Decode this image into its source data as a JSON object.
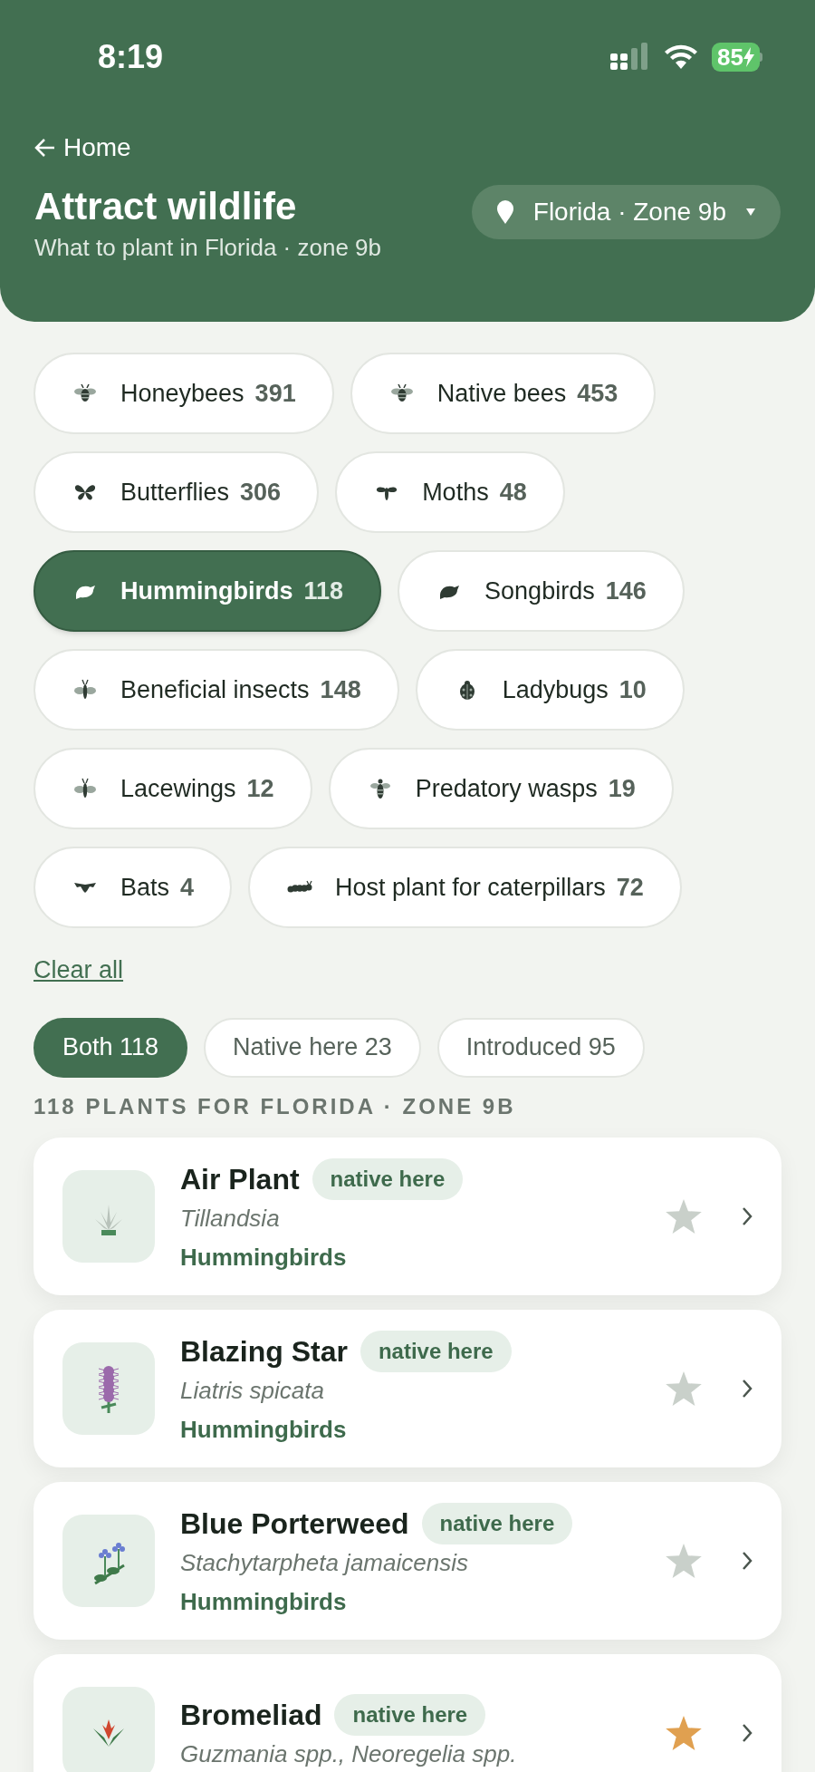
{
  "status_bar": {
    "time": "8:19",
    "battery": "85"
  },
  "header": {
    "back": "Home",
    "title": "Attract wildlife",
    "subtitle": "What to plant in Florida · zone 9b",
    "location": "Florida · Zone 9b"
  },
  "filters": [
    {
      "kind": "bee",
      "label": "Honeybees",
      "count": "391",
      "selected": false
    },
    {
      "kind": "bee",
      "label": "Native bees",
      "count": "453",
      "selected": false
    },
    {
      "kind": "butterfly",
      "label": "Butterflies",
      "count": "306",
      "selected": false
    },
    {
      "kind": "moth",
      "label": "Moths",
      "count": "48",
      "selected": false
    },
    {
      "kind": "bird",
      "label": "Hummingbirds",
      "count": "118",
      "selected": true
    },
    {
      "kind": "bird",
      "label": "Songbirds",
      "count": "146",
      "selected": false
    },
    {
      "kind": "insect",
      "label": "Beneficial insects",
      "count": "148",
      "selected": false
    },
    {
      "kind": "ladybug",
      "label": "Ladybugs",
      "count": "10",
      "selected": false
    },
    {
      "kind": "insect",
      "label": "Lacewings",
      "count": "12",
      "selected": false
    },
    {
      "kind": "wasp",
      "label": "Predatory wasps",
      "count": "19",
      "selected": false
    },
    {
      "kind": "bat",
      "label": "Bats",
      "count": "4",
      "selected": false
    },
    {
      "kind": "caterpillar",
      "label": "Host plant for caterpillars",
      "count": "72",
      "selected": false
    }
  ],
  "clear_all": "Clear all",
  "origin_tabs": [
    {
      "label": "Both 118",
      "selected": true
    },
    {
      "label": "Native here 23",
      "selected": false
    },
    {
      "label": "Introduced 95",
      "selected": false
    }
  ],
  "results_heading": "118 PLANTS FOR FLORIDA · ZONE 9B",
  "plants": [
    {
      "kind": "air-plant",
      "name": "Air Plant",
      "badge": "native here",
      "scientific": "Tillandsia",
      "attracts": "Hummingbirds",
      "favorite": false
    },
    {
      "kind": "spike-flower",
      "name": "Blazing Star",
      "badge": "native here",
      "scientific": "Liatris spicata",
      "attracts": "Hummingbirds",
      "favorite": false
    },
    {
      "kind": "porterweed",
      "name": "Blue Porterweed",
      "badge": "native here",
      "scientific": "Stachytarpheta jamaicensis",
      "attracts": "Hummingbirds",
      "favorite": false
    },
    {
      "kind": "bromeliad",
      "name": "Bromeliad",
      "badge": "native here",
      "scientific": "Guzmania spp., Neoregelia spp.",
      "favorite": true
    }
  ]
}
